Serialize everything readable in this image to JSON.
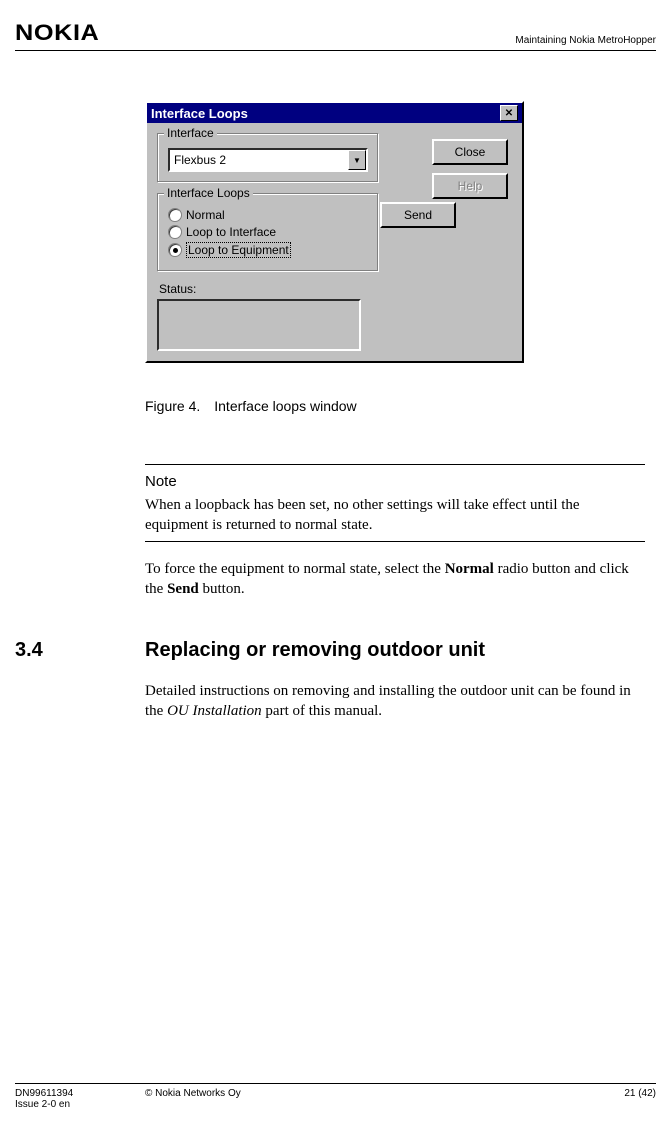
{
  "header": {
    "logo": "NOKIA",
    "right": "Maintaining Nokia MetroHopper"
  },
  "dialog": {
    "title": "Interface Loops",
    "close_glyph": "✕",
    "interface_group_label": "Interface",
    "interface_value": "Flexbus 2",
    "dropdown_arrow": "▼",
    "close_btn": "Close",
    "help_btn": "Help",
    "loops_group_label": "Interface Loops",
    "radio_normal": "Normal",
    "radio_loop_if": "Loop to Interface",
    "radio_loop_eq": "Loop to Equipment",
    "send_btn": "Send",
    "status_label": "Status:"
  },
  "figure_caption": "Figure 4. Interface loops window",
  "note": {
    "heading": "Note",
    "body": "When a loopback has been set, no other settings will take effect until the equipment is returned to normal state."
  },
  "para_force": {
    "pre": "To force the equipment to normal state, select the ",
    "b1": "Normal",
    "mid": " radio button and click the ",
    "b2": "Send",
    "post": " button."
  },
  "section": {
    "num": "3.4",
    "title": "Replacing or removing outdoor unit"
  },
  "para_detail": {
    "pre": "Detailed instructions on removing and installing the outdoor unit can be found in the ",
    "i1": "OU Installation",
    "post": " part of this manual."
  },
  "footer": {
    "doc": "DN99611394",
    "issue": "Issue 2-0 en",
    "copyright": "© Nokia Networks Oy",
    "page": "21 (42)"
  }
}
